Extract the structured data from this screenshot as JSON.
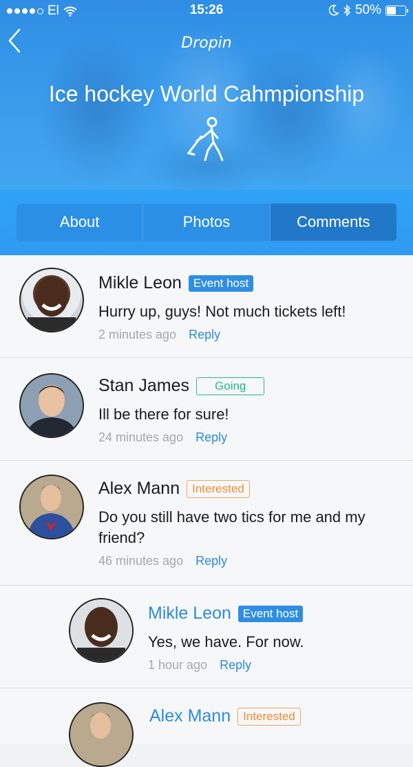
{
  "status_bar": {
    "carrier": "El",
    "time": "15:26",
    "battery": "50%",
    "battery_level": 0.5
  },
  "header": {
    "app_logo": "Dropin",
    "event_title": "Ice hockey World Cahmpionship",
    "icons": {
      "back": "chevron-left-icon",
      "sport": "hockey-player-icon"
    }
  },
  "tabs": [
    {
      "label": "About"
    },
    {
      "label": "Photos"
    },
    {
      "label": "Comments",
      "active": true
    }
  ],
  "comments": [
    {
      "name": "Mikle Leon",
      "badge": "Event host",
      "badge_type": "host",
      "text": "Hurry up, guys! Not much tickets left!",
      "time": "2 minutes ago",
      "reply": "Reply"
    },
    {
      "name": "Stan James",
      "badge": "Going",
      "badge_type": "going",
      "text": "Ill be there for sure!",
      "time": "24 minutes ago",
      "reply": "Reply"
    },
    {
      "name": "Alex Mann",
      "badge": "Interested",
      "badge_type": "interested",
      "text": "Do you still have two tics for me and my friend?",
      "time": "46 minutes ago",
      "reply": "Reply"
    },
    {
      "name": "Mikle Leon",
      "badge": "Event host",
      "badge_type": "host",
      "text": "Yes, we have. For now.",
      "time": "1 hour ago",
      "reply": "Reply",
      "nested": true
    },
    {
      "name": "Alex Mann",
      "badge": "Interested",
      "badge_type": "interested",
      "nested": true
    }
  ],
  "colors": {
    "accent": "#2f8ee4",
    "going": "#26b991",
    "interested": "#ee8e35"
  }
}
